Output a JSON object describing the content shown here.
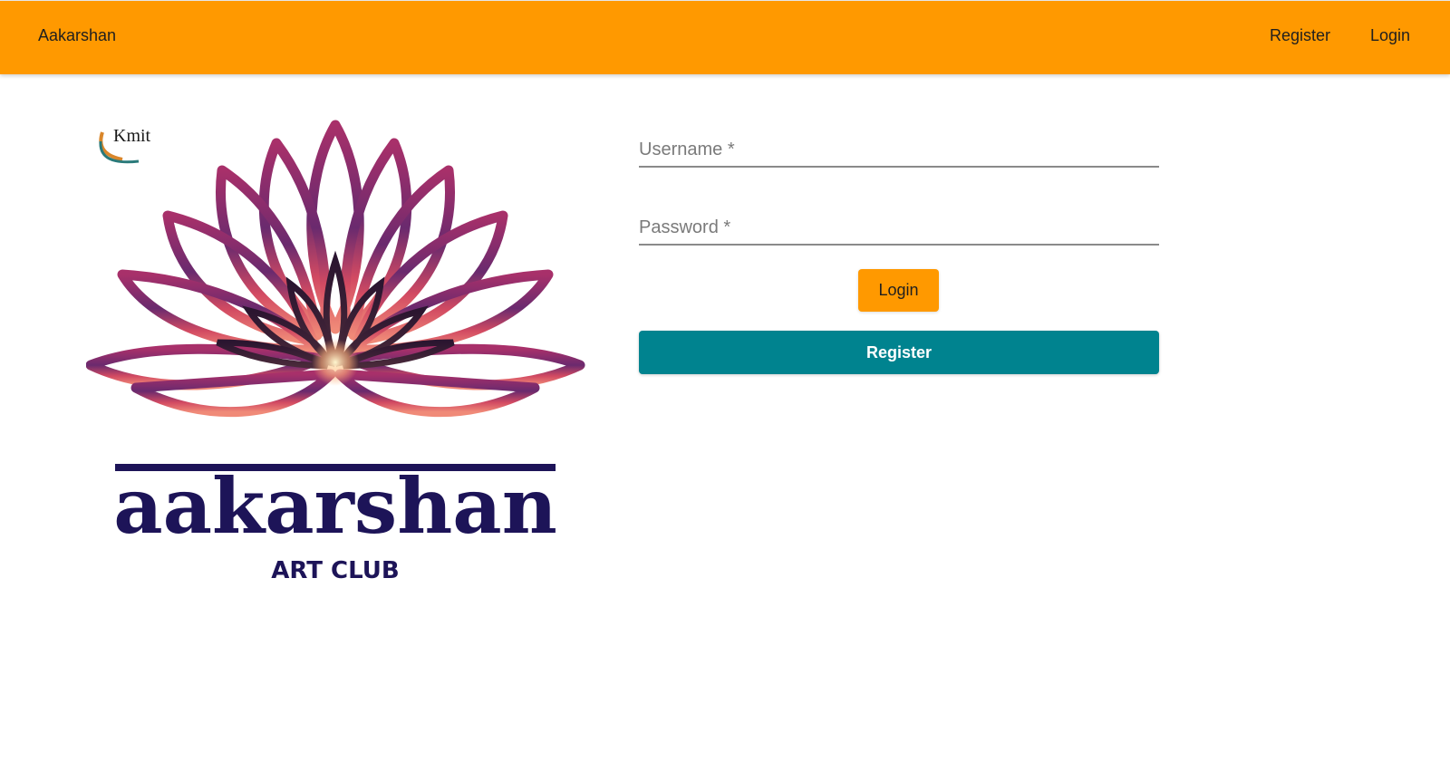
{
  "navbar": {
    "brand": "Aakarshan",
    "register_label": "Register",
    "login_label": "Login"
  },
  "logo": {
    "badge_text": "Kmit",
    "title_text": "aakarshan",
    "subtitle_text": "ART CLUB"
  },
  "form": {
    "username_placeholder": "Username *",
    "password_placeholder": "Password *",
    "login_button": "Login",
    "register_button": "Register"
  },
  "colors": {
    "accent": "#ff9900",
    "register_button": "#00838f",
    "logo_text": "#1d1458"
  }
}
